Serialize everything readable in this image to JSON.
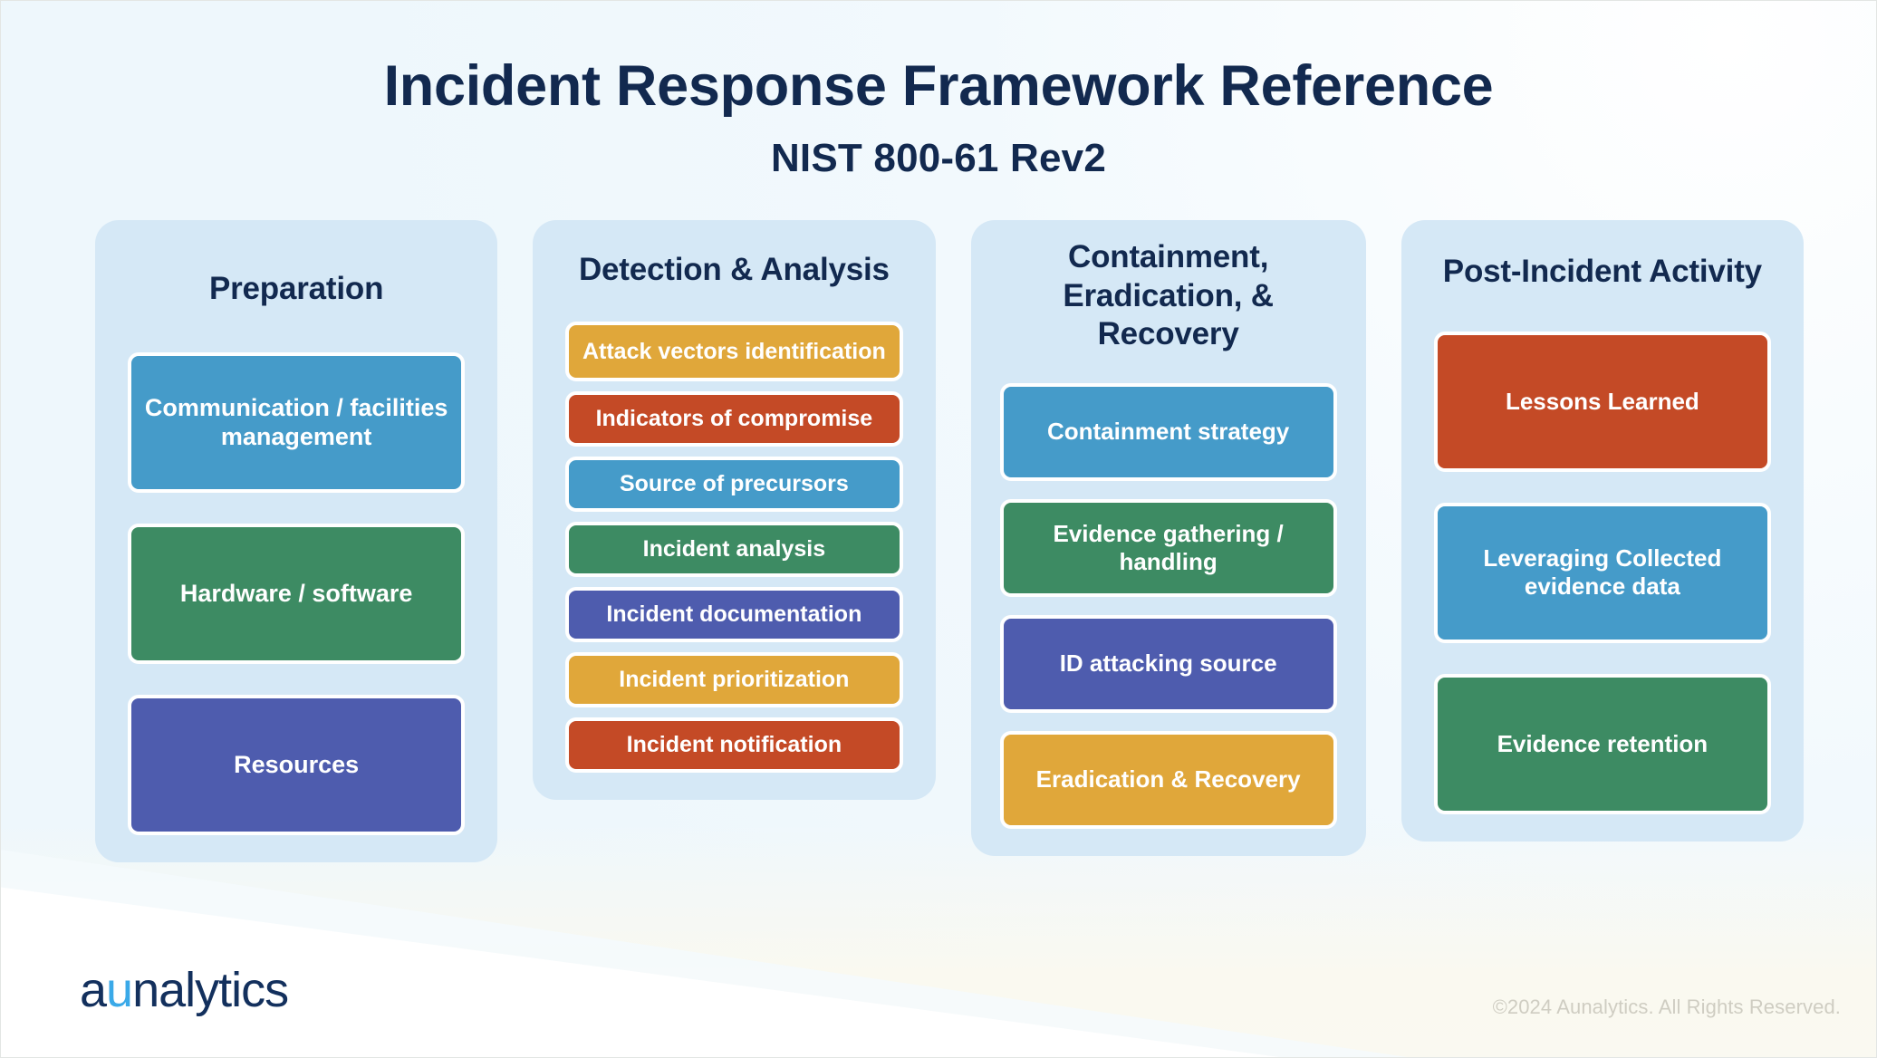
{
  "header": {
    "title": "Incident Response Framework Reference",
    "subtitle": "NIST 800-61 Rev2"
  },
  "colors": {
    "page_background": "#f2f9fd",
    "panel_background": "#d5e8f6",
    "heading_navy": "#12294f",
    "card_blue": "#459bc9",
    "card_green": "#3d8b63",
    "card_purple": "#4e5cae",
    "card_gold": "#e0a73a",
    "card_red": "#c44a26",
    "logo_navy": "#13305d",
    "logo_accent": "#3aa9e8",
    "copyright_gray": "#cfcdc2"
  },
  "columns": [
    {
      "id": "preparation",
      "title": "Preparation",
      "cards": [
        {
          "label": "Communication / facilities management",
          "color": "#459bc9",
          "color_name": "blue"
        },
        {
          "label": "Hardware / software",
          "color": "#3d8b63",
          "color_name": "green"
        },
        {
          "label": "Resources",
          "color": "#4e5cae",
          "color_name": "purple"
        }
      ]
    },
    {
      "id": "detection-analysis",
      "title": "Detection & Analysis",
      "cards": [
        {
          "label": "Attack vectors identification",
          "color": "#e0a73a",
          "color_name": "gold"
        },
        {
          "label": "Indicators of compromise",
          "color": "#c44a26",
          "color_name": "red"
        },
        {
          "label": "Source of precursors",
          "color": "#459bc9",
          "color_name": "blue"
        },
        {
          "label": "Incident analysis",
          "color": "#3d8b63",
          "color_name": "green"
        },
        {
          "label": "Incident documentation",
          "color": "#4e5cae",
          "color_name": "purple"
        },
        {
          "label": "Incident prioritization",
          "color": "#e0a73a",
          "color_name": "gold"
        },
        {
          "label": "Incident notification",
          "color": "#c44a26",
          "color_name": "red"
        }
      ]
    },
    {
      "id": "containment-eradication-recovery",
      "title": "Containment, Eradication, & Recovery",
      "cards": [
        {
          "label": "Containment strategy",
          "color": "#459bc9",
          "color_name": "blue"
        },
        {
          "label": "Evidence gathering / handling",
          "color": "#3d8b63",
          "color_name": "green"
        },
        {
          "label": "ID attacking source",
          "color": "#4e5cae",
          "color_name": "purple"
        },
        {
          "label": "Eradication & Recovery",
          "color": "#e0a73a",
          "color_name": "gold"
        }
      ]
    },
    {
      "id": "post-incident-activity",
      "title": "Post-Incident Activity",
      "cards": [
        {
          "label": "Lessons Learned",
          "color": "#c44a26",
          "color_name": "red"
        },
        {
          "label": "Leveraging Collected evidence data",
          "color": "#459bc9",
          "color_name": "blue"
        },
        {
          "label": "Evidence retention",
          "color": "#3d8b63",
          "color_name": "green"
        }
      ]
    }
  ],
  "footer": {
    "logo_prefix": "a",
    "logo_accent": "u",
    "logo_suffix": "nalytics",
    "copyright": "©2024 Aunalytics. All Rights Reserved."
  }
}
